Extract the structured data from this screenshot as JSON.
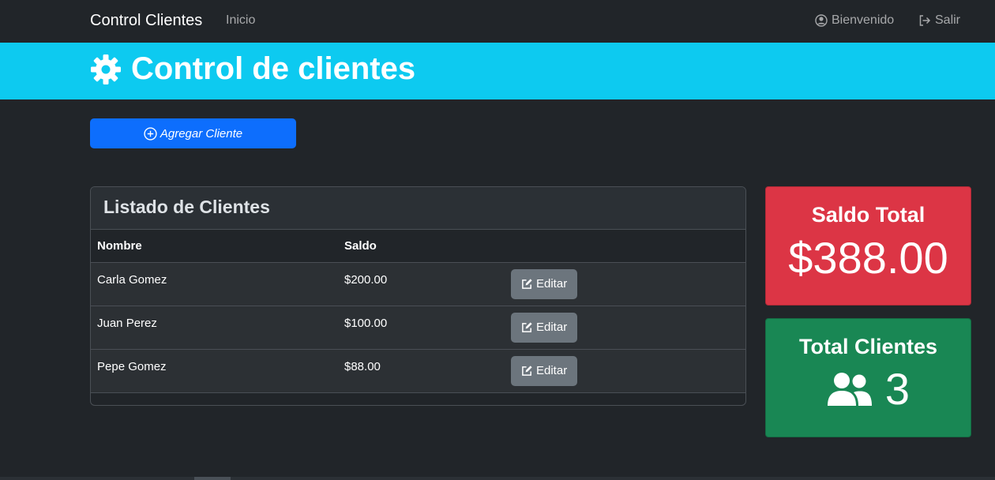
{
  "navbar": {
    "brand": "Control Clientes",
    "inicio": "Inicio",
    "bienvenido": "Bienvenido",
    "salir": "Salir"
  },
  "header": {
    "title": "Control de clientes"
  },
  "actions": {
    "add_label": "Agregar Cliente"
  },
  "list": {
    "title": "Listado de Clientes",
    "columns": [
      "Nombre",
      "Saldo",
      ""
    ],
    "edit_label": "Editar",
    "rows": [
      {
        "nombre": "Carla Gomez",
        "saldo": "$200.00"
      },
      {
        "nombre": "Juan Perez",
        "saldo": "$100.00"
      },
      {
        "nombre": "Pepe Gomez",
        "saldo": "$88.00"
      }
    ]
  },
  "stats": {
    "saldo_title": "Saldo Total",
    "saldo_value": "$388.00",
    "clientes_title": "Total Clientes",
    "clientes_value": "3"
  },
  "colors": {
    "header_band": "#0dcaf0",
    "primary": "#0d6efd",
    "danger": "#dc3545",
    "success": "#198754",
    "secondary": "#6c757d",
    "background": "#212529"
  },
  "icons": {
    "header": "gear-icon",
    "add": "plus-circle-icon",
    "bienvenido": "user-circle-icon",
    "salir": "sign-out-icon",
    "edit": "edit-icon",
    "clientes": "users-icon"
  }
}
